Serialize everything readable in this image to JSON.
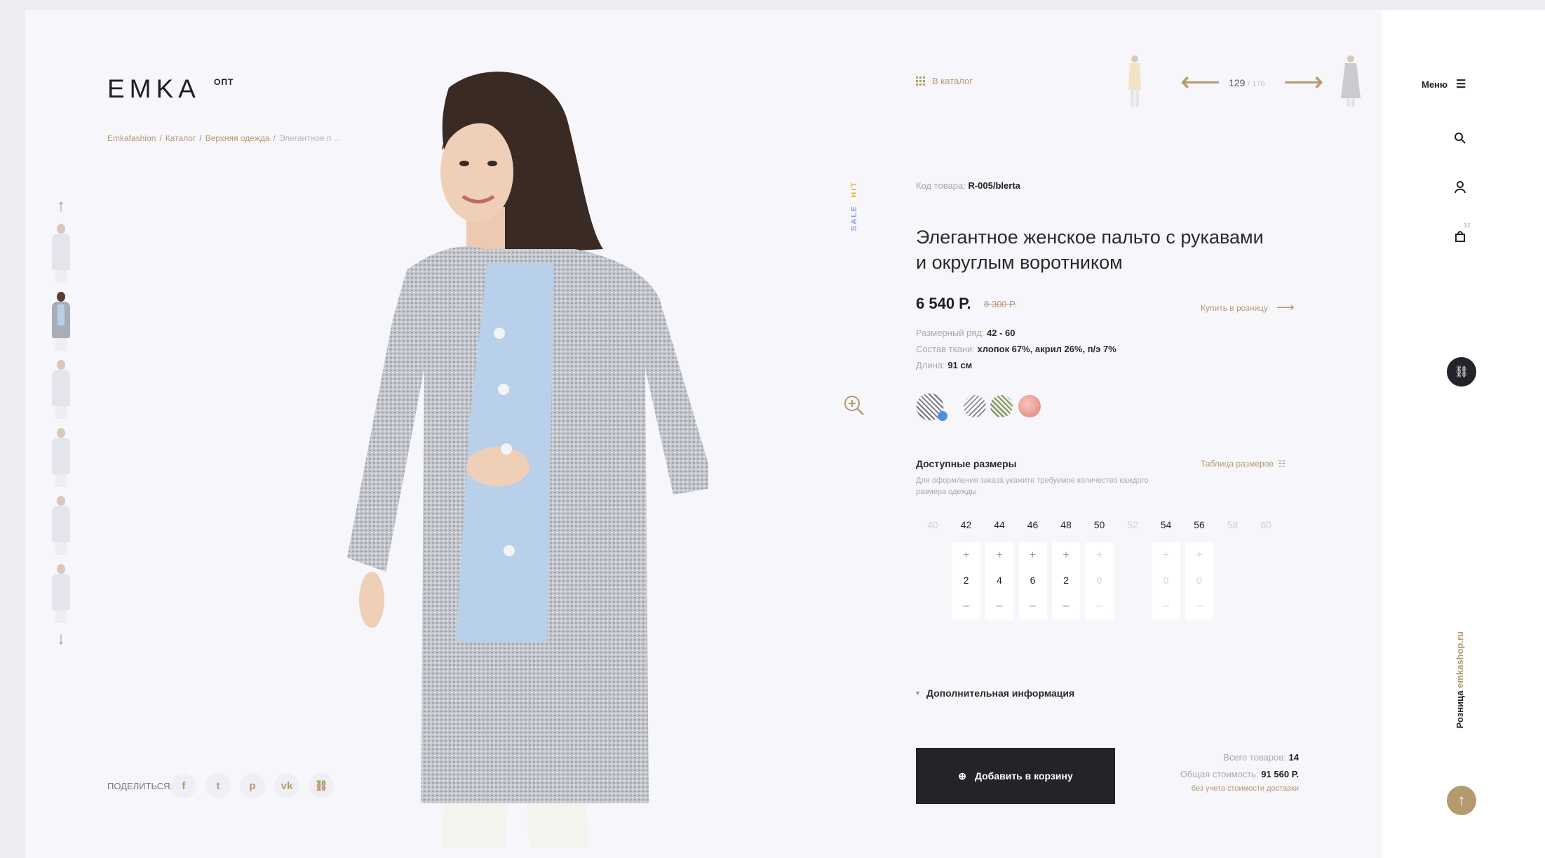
{
  "brand": {
    "logo": "EMKA",
    "sup": "ОПТ"
  },
  "breadcrumb": {
    "items": [
      "Emkafashion",
      "Каталог",
      "Верхняя одежда"
    ],
    "current": "Элегантное п ..."
  },
  "share": {
    "label": "ПОДЕЛИТЬСЯ:",
    "icons": [
      "facebook-icon",
      "twitter-icon",
      "pinterest-icon",
      "vk-icon",
      "link-icon"
    ],
    "glyphs": [
      "f",
      "t",
      "p",
      "vk",
      "⛓"
    ]
  },
  "tags": {
    "sale": "SALE",
    "hit": "HIT"
  },
  "nav": {
    "catalog": "В каталог",
    "current": "129",
    "total": "/ 176"
  },
  "product": {
    "sku_label": "Код товара:",
    "sku": "R-005/blerta",
    "title_line1": "Элегантное женское пальто с рукавами",
    "title_line2": "и округлым воротником",
    "price": "6 540 Р.",
    "old_price": "8 300 Р.",
    "retail_link": "Купить в розницу",
    "specs": [
      {
        "label": "Размерный ряд:",
        "value": "42 - 60"
      },
      {
        "label": "Состав ткани:",
        "value": "хлопок 67%, акрил 26%, п/э 7%"
      },
      {
        "label": "Длина:",
        "value": "91 см"
      }
    ]
  },
  "sizes": {
    "heading": "Доступные размеры",
    "table_link": "Таблица размеров",
    "note": "Для оформления заказа укажите требуемое количество каждого размера одежды",
    "list": [
      "40",
      "42",
      "44",
      "46",
      "48",
      "50",
      "52",
      "54",
      "56",
      "58",
      "60"
    ],
    "available": [
      false,
      true,
      true,
      true,
      true,
      true,
      false,
      true,
      true,
      false,
      false
    ],
    "quantities": [
      {
        "size": "42",
        "qty": "2",
        "active": true
      },
      {
        "size": "44",
        "qty": "4",
        "active": true
      },
      {
        "size": "46",
        "qty": "6",
        "active": true
      },
      {
        "size": "48",
        "qty": "2",
        "active": true
      },
      {
        "size": "50",
        "qty": "0",
        "active": false
      },
      {
        "size": "54",
        "qty": "0",
        "active": false
      },
      {
        "size": "56",
        "qty": "0",
        "active": false
      }
    ],
    "plus": "+",
    "minus": "–"
  },
  "additional_info": "Дополнительная информация",
  "cart": {
    "button": "Добавить в корзину",
    "total_items_label": "Всего товаров:",
    "total_items": "14",
    "total_cost_label": "Общая стоимость:",
    "total_cost": "91 560 Р.",
    "delivery_note": "без учета стоимости доставки"
  },
  "sidebar": {
    "menu": "Меню",
    "cart_count": "12",
    "retail_site": "Розница ",
    "retail_domain": "emkashop.ru"
  },
  "colors": {
    "accent": "#b59a6e",
    "dark": "#23232a",
    "sale": "#8b9df0",
    "hit": "#e0b63c"
  }
}
